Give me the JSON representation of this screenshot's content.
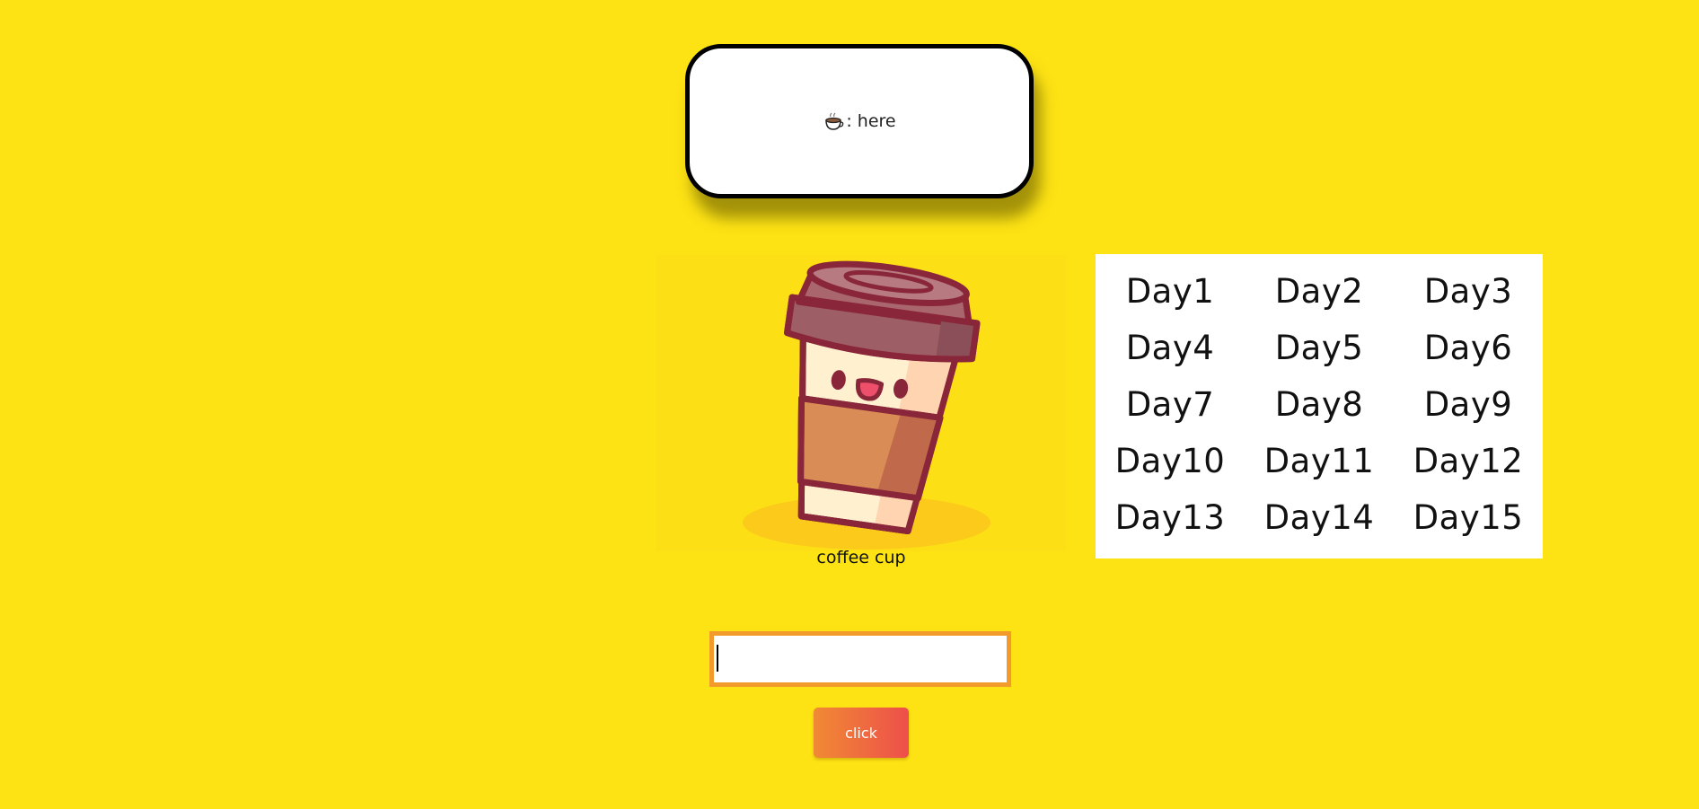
{
  "bubble": {
    "icon": "coffee-cup-emoji-icon",
    "text": ": here"
  },
  "figure": {
    "image": "coffee-cup-illustration",
    "caption": "coffee cup"
  },
  "days": {
    "items": [
      "Day1",
      "Day2",
      "Day3",
      "Day4",
      "Day5",
      "Day6",
      "Day7",
      "Day8",
      "Day9",
      "Day10",
      "Day11",
      "Day12",
      "Day13",
      "Day14",
      "Day15"
    ]
  },
  "input": {
    "value": "",
    "placeholder": ""
  },
  "button": {
    "label": "click"
  },
  "colors": {
    "background": "#fde314",
    "input_border": "#f29a2c",
    "button_start": "#f08a34",
    "button_end": "#ee4f4a"
  }
}
